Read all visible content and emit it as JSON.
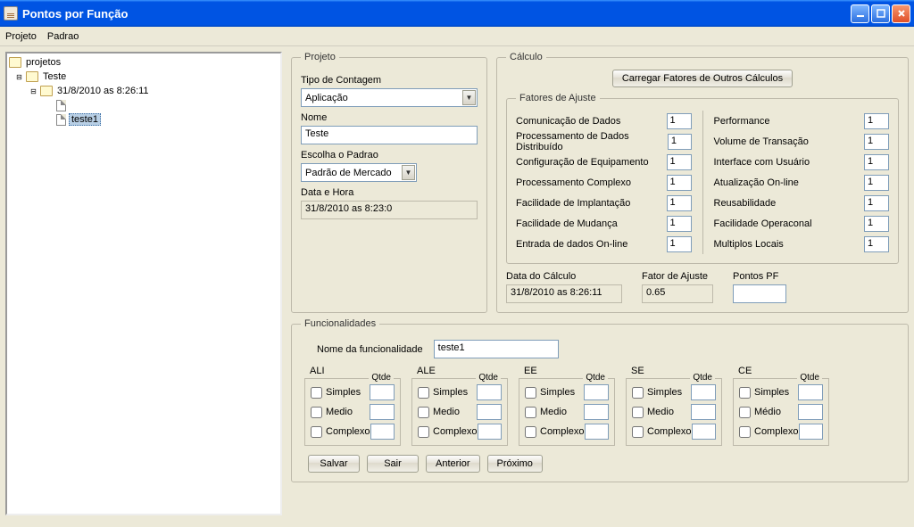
{
  "window": {
    "title": "Pontos por Função"
  },
  "menu": {
    "projeto": "Projeto",
    "padrao": "Padrao"
  },
  "tree": {
    "root": "projetos",
    "l1": "Teste",
    "l2": "31/8/2010 as 8:26:11",
    "l3a": "",
    "l3b": "teste1"
  },
  "projeto": {
    "legend": "Projeto",
    "tipo_label": "Tipo de Contagem",
    "tipo_value": "Aplicação",
    "nome_label": "Nome",
    "nome_value": "Teste",
    "padrao_label": "Escolha o Padrao",
    "padrao_value": "Padrão de Mercado",
    "datahora_label": "Data e Hora",
    "datahora_value": "31/8/2010 as 8:23:0"
  },
  "calculo": {
    "legend": "Cálculo",
    "carregar_btn": "Carregar Fatores de Outros Cálculos",
    "fatores_legend": "Fatores de Ajuste",
    "left": [
      {
        "label": "Comunicação de Dados",
        "val": "1"
      },
      {
        "label": "Processamento de Dados Distribuído",
        "val": "1"
      },
      {
        "label": "Configuração de Equipamento",
        "val": "1"
      },
      {
        "label": "Processamento Complexo",
        "val": "1"
      },
      {
        "label": "Facilidade de Implantação",
        "val": "1"
      },
      {
        "label": "Facilidade de Mudança",
        "val": "1"
      },
      {
        "label": "Entrada de dados On-line",
        "val": "1"
      }
    ],
    "right": [
      {
        "label": "Performance",
        "val": "1"
      },
      {
        "label": "Volume de Transação",
        "val": "1"
      },
      {
        "label": "Interface com Usuário",
        "val": "1"
      },
      {
        "label": "Atualização On-line",
        "val": "1"
      },
      {
        "label": "Reusabilidade",
        "val": "1"
      },
      {
        "label": "Facilidade Operaconal",
        "val": "1"
      },
      {
        "label": "Multiplos Locais",
        "val": "1"
      }
    ],
    "data_label": "Data do Cálculo",
    "data_value": "31/8/2010 as 8:26:11",
    "fator_label": "Fator de Ajuste",
    "fator_value": "0.65",
    "pontos_label": "Pontos PF",
    "pontos_value": ""
  },
  "func": {
    "legend": "Funcionalidades",
    "nome_label": "Nome da funcionalidade",
    "nome_value": "teste1",
    "qtde": "Qtde",
    "groups": [
      "ALI",
      "ALE",
      "EE",
      "SE",
      "CE"
    ],
    "rows_default": [
      "Simples",
      "Medio",
      "Complexo"
    ],
    "rows_ce": [
      "Simples",
      "Médio",
      "Complexo"
    ],
    "btns": {
      "salvar": "Salvar",
      "sair": "Sair",
      "anterior": "Anterior",
      "proximo": "Próximo"
    }
  }
}
